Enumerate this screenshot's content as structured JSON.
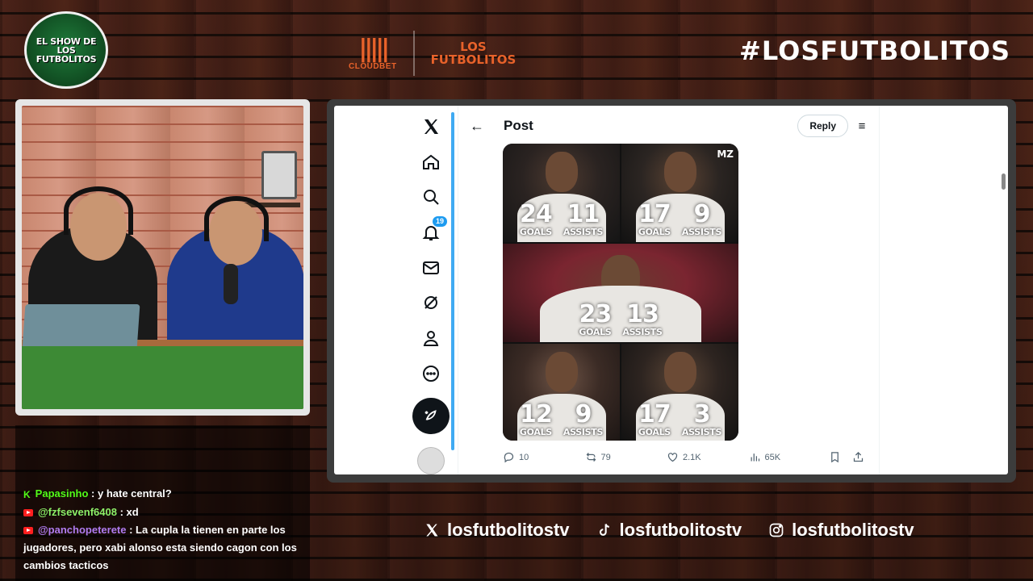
{
  "overlay": {
    "show_logo": [
      "EL SHOW DE LOS",
      "FUTBOLITOS"
    ],
    "sponsor_name": "CLOUDBET",
    "brand_line1": "LOS",
    "brand_line2": "FUTBOLITOS",
    "hashtag": "#LOSFUTBOLITOS"
  },
  "chat": {
    "messages": [
      {
        "platform": "kick",
        "user": "Papasinho",
        "text": " : y hate central?"
      },
      {
        "platform": "youtube",
        "user": "@fzfsevenf6408",
        "text": " : xd"
      },
      {
        "platform": "youtube",
        "user": "@panchopeterete",
        "text": " : La cupla la tienen en parte los jugadores, pero xabi alonso esta siendo cagon con los cambios tacticos"
      }
    ]
  },
  "x": {
    "notifications_badge": "19",
    "post_title": "Post",
    "reply_label": "Reply",
    "media": {
      "watermark": "MZ",
      "tiles": [
        {
          "goals": "24",
          "assists": "11",
          "goals_label": "GOALS",
          "assists_label": "ASSISTS"
        },
        {
          "goals": "17",
          "assists": "9",
          "goals_label": "GOALS",
          "assists_label": "ASSISTS"
        },
        {
          "goals": "23",
          "assists": "13",
          "goals_label": "GOALS",
          "assists_label": "ASSISTS"
        },
        {
          "goals": "12",
          "assists": "9",
          "goals_label": "GOALS",
          "assists_label": "ASSISTS"
        },
        {
          "goals": "17",
          "assists": "3",
          "goals_label": "GOALS",
          "assists_label": "ASSISTS"
        }
      ]
    },
    "actions": {
      "replies": "10",
      "reposts": "79",
      "likes": "2.1K",
      "views": "65K"
    }
  },
  "socials": [
    {
      "icon": "x-icon",
      "handle": "losfutbolitostv"
    },
    {
      "icon": "tiktok-icon",
      "handle": "losfutbolitostv"
    },
    {
      "icon": "instagram-icon",
      "handle": "losfutbolitostv"
    }
  ],
  "colors": {
    "brand_orange": "#e8622a",
    "x_blue": "#1d9bf0",
    "kick_green": "#53fc18"
  }
}
